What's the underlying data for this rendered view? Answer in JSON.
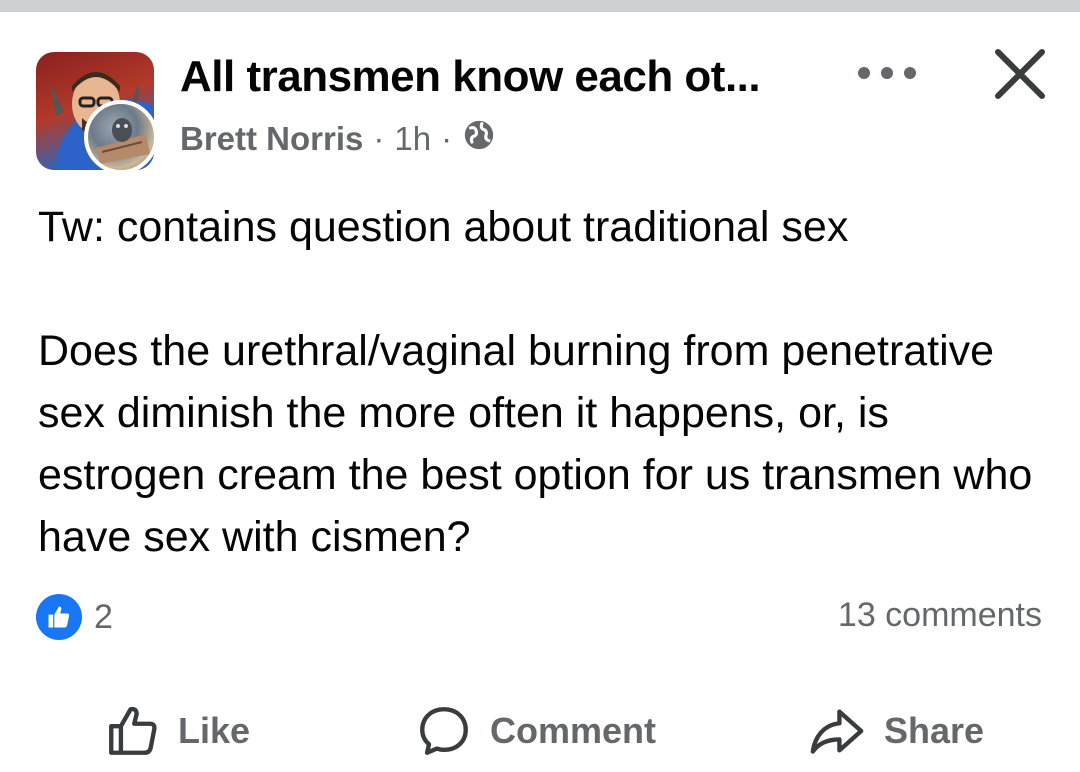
{
  "post": {
    "group_title": "All transmen know each ot...",
    "author": "Brett Norris",
    "separator": "·",
    "time": "1h",
    "privacy_icon": "globe-icon",
    "body": {
      "line1": "Tw: contains question about traditional sex",
      "paragraph2": "Does the urethral/vaginal burning from penetrative sex diminish the more often it happens, or, is estrogen cream the best option for us transmen who have sex with cismen?"
    },
    "reaction_count": "2",
    "comments_count": "13 comments"
  },
  "actions": {
    "like": "Like",
    "comment": "Comment",
    "share": "Share"
  },
  "colors": {
    "accent": "#1877f2",
    "secondary_text": "#65676b",
    "top_bar": "#ced0d4"
  }
}
